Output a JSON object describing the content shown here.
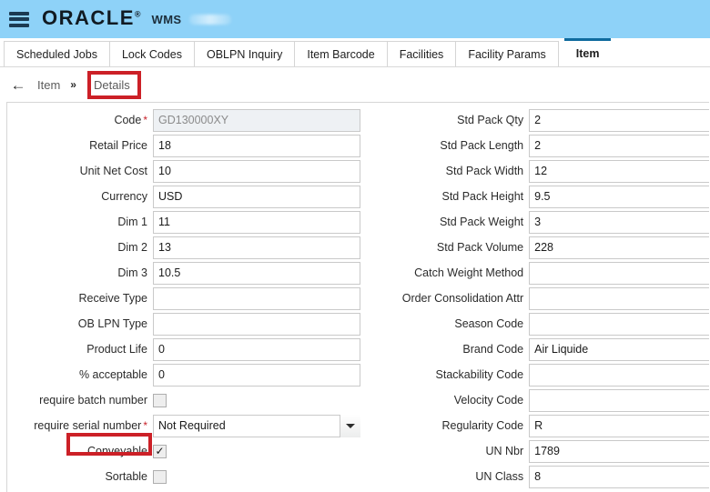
{
  "header": {
    "menu_icon": "hamburger-icon",
    "brand": "ORACLE",
    "brand_reg": "®",
    "app_name": "WMS",
    "brand_color": "#111a22",
    "bar_color": "#8ed2f8"
  },
  "tabs": [
    {
      "label": "Scheduled Jobs",
      "active": false
    },
    {
      "label": "Lock Codes",
      "active": false
    },
    {
      "label": "OBLPN Inquiry",
      "active": false
    },
    {
      "label": "Item Barcode",
      "active": false
    },
    {
      "label": "Facilities",
      "active": false
    },
    {
      "label": "Facility Params",
      "active": false
    },
    {
      "label": "Item",
      "active": true
    }
  ],
  "breadcrumb": {
    "back_icon": "back-arrow-icon",
    "parent": "Item",
    "separator": "»",
    "current": "Details"
  },
  "highlights": {
    "color": "#cc2027",
    "targets": [
      "Details",
      "Conveyable"
    ]
  },
  "form": {
    "left_fields": [
      {
        "label": "Code",
        "value": "GD130000XY",
        "type": "text",
        "required": true,
        "disabled": true
      },
      {
        "label": "Retail Price",
        "value": "18",
        "type": "text",
        "required": false,
        "disabled": false
      },
      {
        "label": "Unit Net Cost",
        "value": "10",
        "type": "text",
        "required": false,
        "disabled": false
      },
      {
        "label": "Currency",
        "value": "USD",
        "type": "text",
        "required": false,
        "disabled": false
      },
      {
        "label": "Dim 1",
        "value": "11",
        "type": "text",
        "required": false,
        "disabled": false
      },
      {
        "label": "Dim 2",
        "value": "13",
        "type": "text",
        "required": false,
        "disabled": false
      },
      {
        "label": "Dim 3",
        "value": "10.5",
        "type": "text",
        "required": false,
        "disabled": false
      },
      {
        "label": "Receive Type",
        "value": "",
        "type": "text",
        "required": false,
        "disabled": false
      },
      {
        "label": "OB LPN Type",
        "value": "",
        "type": "text",
        "required": false,
        "disabled": false
      },
      {
        "label": "Product Life",
        "value": "0",
        "type": "text",
        "required": false,
        "disabled": false
      },
      {
        "label": "% acceptable",
        "value": "0",
        "type": "text",
        "required": false,
        "disabled": false
      },
      {
        "label": "require batch number",
        "value": "",
        "type": "checkbox",
        "required": false,
        "checked": false
      },
      {
        "label": "require serial number",
        "value": "Not Required",
        "type": "select",
        "required": true,
        "disabled": false
      },
      {
        "label": "Conveyable",
        "value": "",
        "type": "checkbox",
        "required": false,
        "checked": true
      },
      {
        "label": "Sortable",
        "value": "",
        "type": "checkbox",
        "required": false,
        "checked": false
      }
    ],
    "right_fields": [
      {
        "label": "Std Pack Qty",
        "value": "2",
        "type": "text"
      },
      {
        "label": "Std Pack Length",
        "value": "2",
        "type": "text"
      },
      {
        "label": "Std Pack Width",
        "value": "12",
        "type": "text"
      },
      {
        "label": "Std Pack Height",
        "value": "9.5",
        "type": "text"
      },
      {
        "label": "Std Pack Weight",
        "value": "3",
        "type": "text"
      },
      {
        "label": "Std Pack Volume",
        "value": "228",
        "type": "text"
      },
      {
        "label": "Catch Weight Method",
        "value": "",
        "type": "text"
      },
      {
        "label": "Order Consolidation Attr",
        "value": "",
        "type": "text"
      },
      {
        "label": "Season Code",
        "value": "",
        "type": "text"
      },
      {
        "label": "Brand Code",
        "value": "Air Liquide",
        "type": "text"
      },
      {
        "label": "Stackability Code",
        "value": "",
        "type": "text"
      },
      {
        "label": "Velocity Code",
        "value": "",
        "type": "text"
      },
      {
        "label": "Regularity Code",
        "value": "R",
        "type": "text"
      },
      {
        "label": "UN Nbr",
        "value": "1789",
        "type": "text"
      },
      {
        "label": "UN Class",
        "value": "8",
        "type": "text"
      }
    ],
    "checkbox_check_glyph": "✓",
    "required_marker": "*"
  }
}
